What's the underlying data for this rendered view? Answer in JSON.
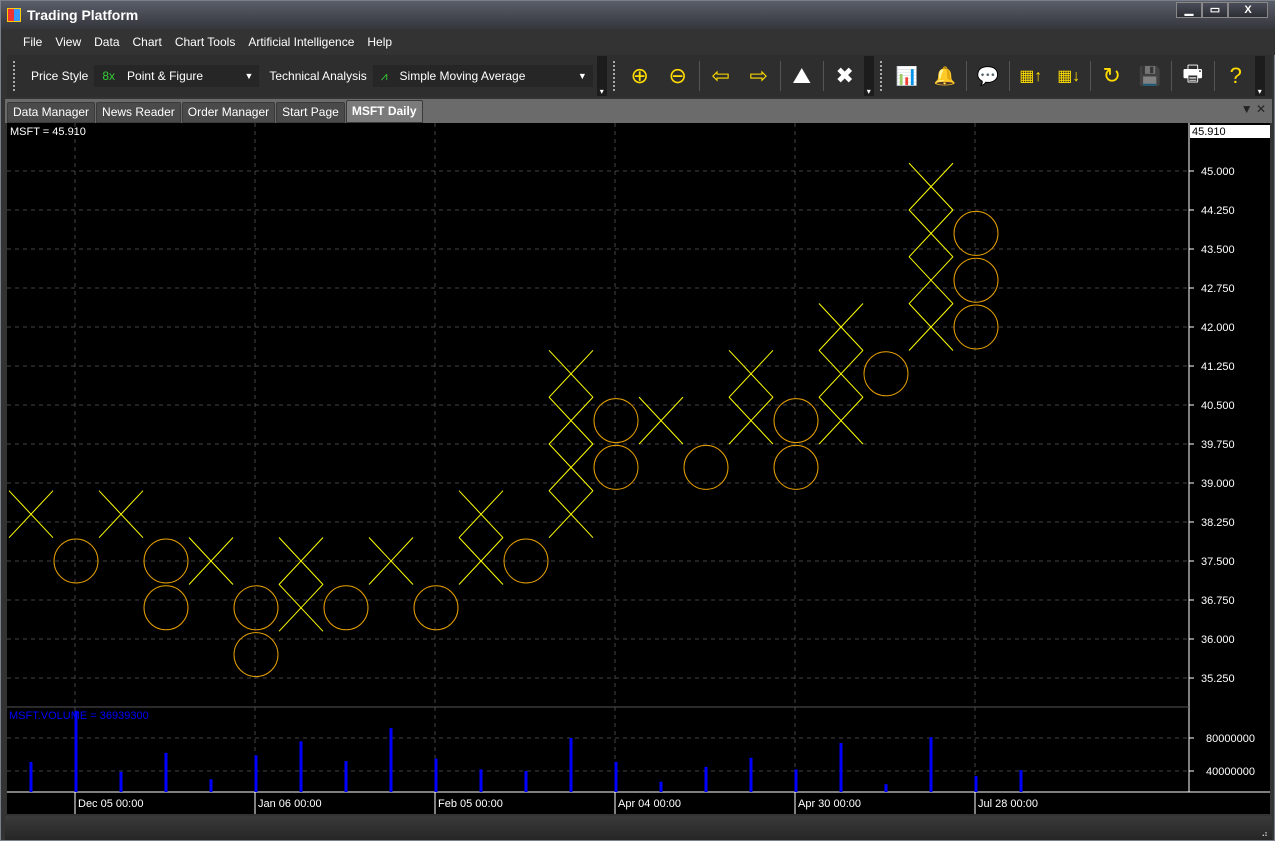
{
  "window": {
    "title": "Trading Platform",
    "minimize": "▁",
    "maximize": "▭",
    "close": "X"
  },
  "menu": [
    "File",
    "View",
    "Data",
    "Chart",
    "Chart Tools",
    "Artificial Intelligence",
    "Help"
  ],
  "toolbar": {
    "price_style_label": "Price Style",
    "price_style_value": "Point & Figure",
    "price_style_icon": "8x",
    "technical_label": "Technical Analysis",
    "technical_value": "Simple Moving Average",
    "buttons": [
      {
        "name": "zoom-in",
        "glyph": "⊕"
      },
      {
        "name": "zoom-out",
        "glyph": "⊖"
      },
      {
        "name": "scroll-left",
        "glyph": "⇦"
      },
      {
        "name": "scroll-right",
        "glyph": "⇨"
      },
      {
        "name": "chart-overlay",
        "glyph": "⛰"
      },
      {
        "name": "delete",
        "glyph": "✖"
      },
      {
        "name": "candlestick-chart",
        "glyph": "📊"
      },
      {
        "name": "alert-bell",
        "glyph": "🔔"
      },
      {
        "name": "message",
        "glyph": "💬"
      },
      {
        "name": "import-data",
        "glyph": "▦↑"
      },
      {
        "name": "export-data",
        "glyph": "▦↓"
      },
      {
        "name": "open-file",
        "glyph": "↻"
      },
      {
        "name": "save",
        "glyph": "💾"
      },
      {
        "name": "print",
        "glyph": "🖶"
      },
      {
        "name": "help-web",
        "glyph": "?"
      }
    ]
  },
  "tabs": [
    {
      "label": "Data Manager"
    },
    {
      "label": "News Reader"
    },
    {
      "label": "Order Manager"
    },
    {
      "label": "Start Page"
    },
    {
      "label": "MSFT Daily",
      "active": true
    }
  ],
  "tab_controls": {
    "dropdown": "▼",
    "close": "✕"
  },
  "chart_data": {
    "type": "point-and-figure",
    "price_label": "MSFT = 45.910",
    "last_price": "45.910",
    "price_ticks": [
      "45.000",
      "44.250",
      "43.500",
      "42.750",
      "42.000",
      "41.250",
      "40.500",
      "39.750",
      "39.000",
      "38.250",
      "37.500",
      "36.750",
      "36.000",
      "35.250"
    ],
    "price_range": [
      34.8,
      45.9
    ],
    "colors": {
      "x": "#ffff00",
      "o": "#e6a000",
      "volume": "#0000ff",
      "grid": "#444444"
    },
    "columns": [
      {
        "type": "X",
        "boxes": [
          38.4
        ]
      },
      {
        "type": "O",
        "boxes": [
          37.5
        ]
      },
      {
        "type": "X",
        "boxes": [
          38.4
        ]
      },
      {
        "type": "O",
        "boxes": [
          37.5,
          36.6
        ]
      },
      {
        "type": "X",
        "boxes": [
          37.5
        ]
      },
      {
        "type": "O",
        "boxes": [
          36.6,
          35.7
        ]
      },
      {
        "type": "X",
        "boxes": [
          36.6,
          37.5
        ]
      },
      {
        "type": "O",
        "boxes": [
          36.6
        ]
      },
      {
        "type": "X",
        "boxes": [
          37.5
        ]
      },
      {
        "type": "O",
        "boxes": [
          36.6
        ]
      },
      {
        "type": "X",
        "boxes": [
          37.5,
          38.4
        ]
      },
      {
        "type": "O",
        "boxes": [
          37.5
        ]
      },
      {
        "type": "X",
        "boxes": [
          38.4,
          39.3,
          40.2,
          41.1
        ]
      },
      {
        "type": "O",
        "boxes": [
          40.2,
          39.3
        ]
      },
      {
        "type": "X",
        "boxes": [
          40.2
        ]
      },
      {
        "type": "O",
        "boxes": [
          39.3
        ]
      },
      {
        "type": "X",
        "boxes": [
          40.2,
          41.1
        ]
      },
      {
        "type": "O",
        "boxes": [
          40.2,
          39.3
        ]
      },
      {
        "type": "X",
        "boxes": [
          40.2,
          41.1,
          42.0
        ]
      },
      {
        "type": "O",
        "boxes": [
          41.1
        ]
      },
      {
        "type": "X",
        "boxes": [
          42.0,
          42.9,
          43.8,
          44.7
        ]
      },
      {
        "type": "O",
        "boxes": [
          43.8,
          42.9,
          42.0
        ]
      }
    ],
    "volume_label": "MSFT.VOLUME = 36939300",
    "volume_ticks": [
      "80000000",
      "40000000"
    ],
    "volume": [
      51000000,
      113000000,
      39000000,
      62000000,
      30000000,
      59000000,
      76000000,
      52000000,
      92000000,
      55000000,
      42000000,
      40000000,
      80000000,
      51000000,
      27000000,
      45000000,
      56000000,
      42000000,
      74000000,
      24000000,
      81000000,
      34000000,
      41000000
    ],
    "time_labels": [
      "Dec 05 00:00",
      "Jan 06 00:00",
      "Feb 05 00:00",
      "Apr 04 00:00",
      "Apr 30 00:00",
      "Jul 28 00:00"
    ]
  }
}
